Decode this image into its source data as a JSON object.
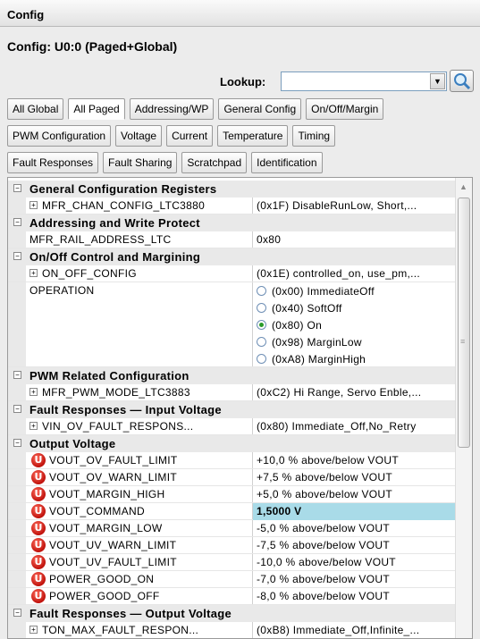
{
  "window": {
    "title": "Config"
  },
  "panel": {
    "subtitle": "Config: U0:0 (Paged+Global)"
  },
  "lookup": {
    "label": "Lookup:",
    "value": ""
  },
  "tabs_row1": [
    "All Global",
    "All Paged",
    "Addressing/WP",
    "General Config",
    "On/Off/Margin"
  ],
  "tabs_row2": [
    "PWM Configuration",
    "Voltage",
    "Current",
    "Temperature",
    "Timing"
  ],
  "tabs_row3": [
    "Fault Responses",
    "Fault Sharing",
    "Scratchpad",
    "Identification"
  ],
  "active_tab": "All Paged",
  "grid": {
    "general": {
      "category": "General Configuration Registers",
      "items": [
        {
          "name": "MFR_CHAN_CONFIG_LTC3880",
          "value": "(0x1F) DisableRunLow, Short,..."
        }
      ]
    },
    "addressing": {
      "category": "Addressing and Write Protect",
      "items": [
        {
          "name": "MFR_RAIL_ADDRESS_LTC",
          "value": "0x80"
        }
      ]
    },
    "onoff": {
      "category": "On/Off Control and Margining",
      "items": [
        {
          "name": "ON_OFF_CONFIG",
          "value": "(0x1E)  controlled_on, use_pm,..."
        },
        {
          "name": "OPERATION"
        }
      ],
      "operation_options": [
        "(0x00) ImmediateOff",
        "(0x40) SoftOff",
        "(0x80) On",
        "(0x98) MarginLow",
        "(0xA8) MarginHigh"
      ],
      "operation_selected": "(0x80) On"
    },
    "pwm": {
      "category": "PWM Related Configuration",
      "items": [
        {
          "name": "MFR_PWM_MODE_LTC3883",
          "value": "(0xC2) Hi Range, Servo Enble,..."
        }
      ]
    },
    "fault_input": {
      "category": "Fault Responses — Input Voltage",
      "items": [
        {
          "name": "VIN_OV_FAULT_RESPONS...",
          "value": "(0x80) Immediate_Off,No_Retry"
        }
      ]
    },
    "output": {
      "category": "Output Voltage",
      "items": [
        {
          "name": "VOUT_OV_FAULT_LIMIT",
          "value": "+10,0 % above/below VOUT"
        },
        {
          "name": "VOUT_OV_WARN_LIMIT",
          "value": "+7,5 % above/below VOUT"
        },
        {
          "name": "VOUT_MARGIN_HIGH",
          "value": "+5,0 % above/below VOUT"
        },
        {
          "name": "VOUT_COMMAND",
          "value": "1,5000 V"
        },
        {
          "name": "VOUT_MARGIN_LOW",
          "value": "-5,0 % above/below VOUT"
        },
        {
          "name": "VOUT_UV_WARN_LIMIT",
          "value": "-7,5 % above/below VOUT"
        },
        {
          "name": "VOUT_UV_FAULT_LIMIT",
          "value": "-10,0 % above/below VOUT"
        },
        {
          "name": "POWER_GOOD_ON",
          "value": "-7,0 % above/below VOUT"
        },
        {
          "name": "POWER_GOOD_OFF",
          "value": "-8,0 % above/below VOUT"
        }
      ]
    },
    "fault_output": {
      "category": "Fault Responses — Output Voltage",
      "items": [
        {
          "name": "TON_MAX_FAULT_RESPON...",
          "value": "(0xB8) Immediate_Off,Infinite_..."
        }
      ]
    }
  },
  "icons": {
    "expander": "minus-box-icon",
    "expand": "plus-box-icon",
    "warning": "u-warning-icon",
    "search": "magnifier-icon",
    "dropdown": "chevron-down-icon"
  },
  "colors": {
    "highlight": "#a9dbe8",
    "category_bg": "#e9e9e9",
    "warning": "#c0120c"
  }
}
